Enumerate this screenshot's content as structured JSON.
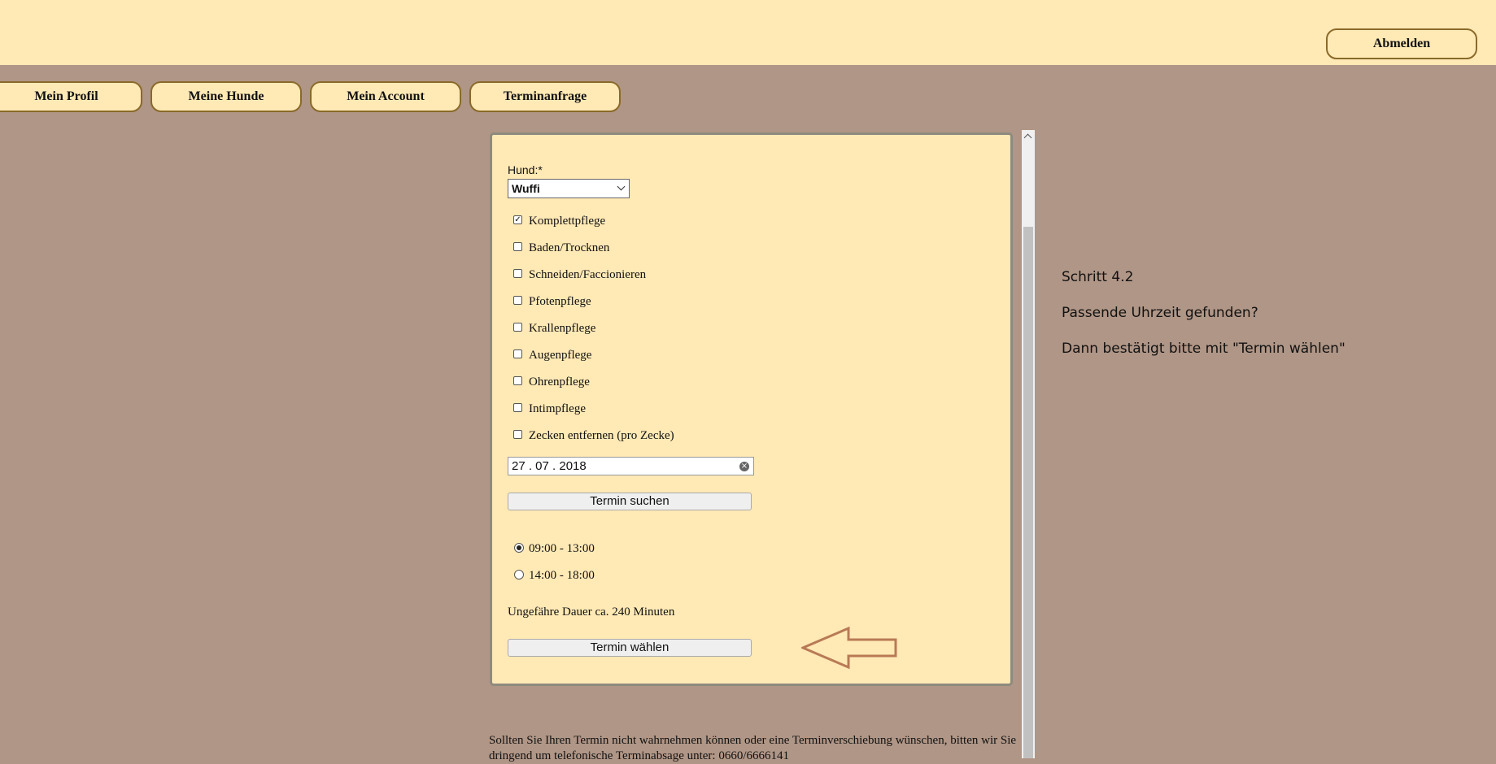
{
  "header": {
    "logout_label": "Abmelden"
  },
  "nav": {
    "profil": "Mein Profil",
    "hunde": "Meine Hunde",
    "account": "Mein Account",
    "terminanfrage": "Terminanfrage"
  },
  "form": {
    "dog_label": "Hund:*",
    "dog_selected": "Wuffi",
    "services": [
      {
        "label": "Komplettpflege",
        "checked": true
      },
      {
        "label": "Baden/Trocknen",
        "checked": false
      },
      {
        "label": "Schneiden/Faccionieren",
        "checked": false
      },
      {
        "label": "Pfotenpflege",
        "checked": false
      },
      {
        "label": "Krallenpflege",
        "checked": false
      },
      {
        "label": "Augenpflege",
        "checked": false
      },
      {
        "label": "Ohrenpflege",
        "checked": false
      },
      {
        "label": "Intimpflege",
        "checked": false
      },
      {
        "label": "Zecken entfernen (pro Zecke)",
        "checked": false
      }
    ],
    "date_value": "27 . 07 . 2018",
    "search_button": "Termin suchen",
    "slots": [
      {
        "label": "09:00 - 13:00",
        "selected": true
      },
      {
        "label": "14:00 - 18:00",
        "selected": false
      }
    ],
    "duration_text": "Ungefähre Dauer ca. 240 Minuten",
    "choose_button": "Termin wählen"
  },
  "help": {
    "step": "Schritt 4.2",
    "question": "Passende Uhrzeit gefunden?",
    "instruction": "Dann bestätigt bitte mit \"Termin wählen\""
  },
  "footer": {
    "note": "Sollten Sie Ihren Termin nicht wahrnehmen können oder eine Terminverschiebung wünschen, bitten wir Sie dringend um telefonische Terminabsage unter: 0660/6666141"
  },
  "colors": {
    "background": "#b09686",
    "panel": "#ffe9b5",
    "pill_border": "#8a6a2a",
    "arrow": "#b87a55"
  }
}
